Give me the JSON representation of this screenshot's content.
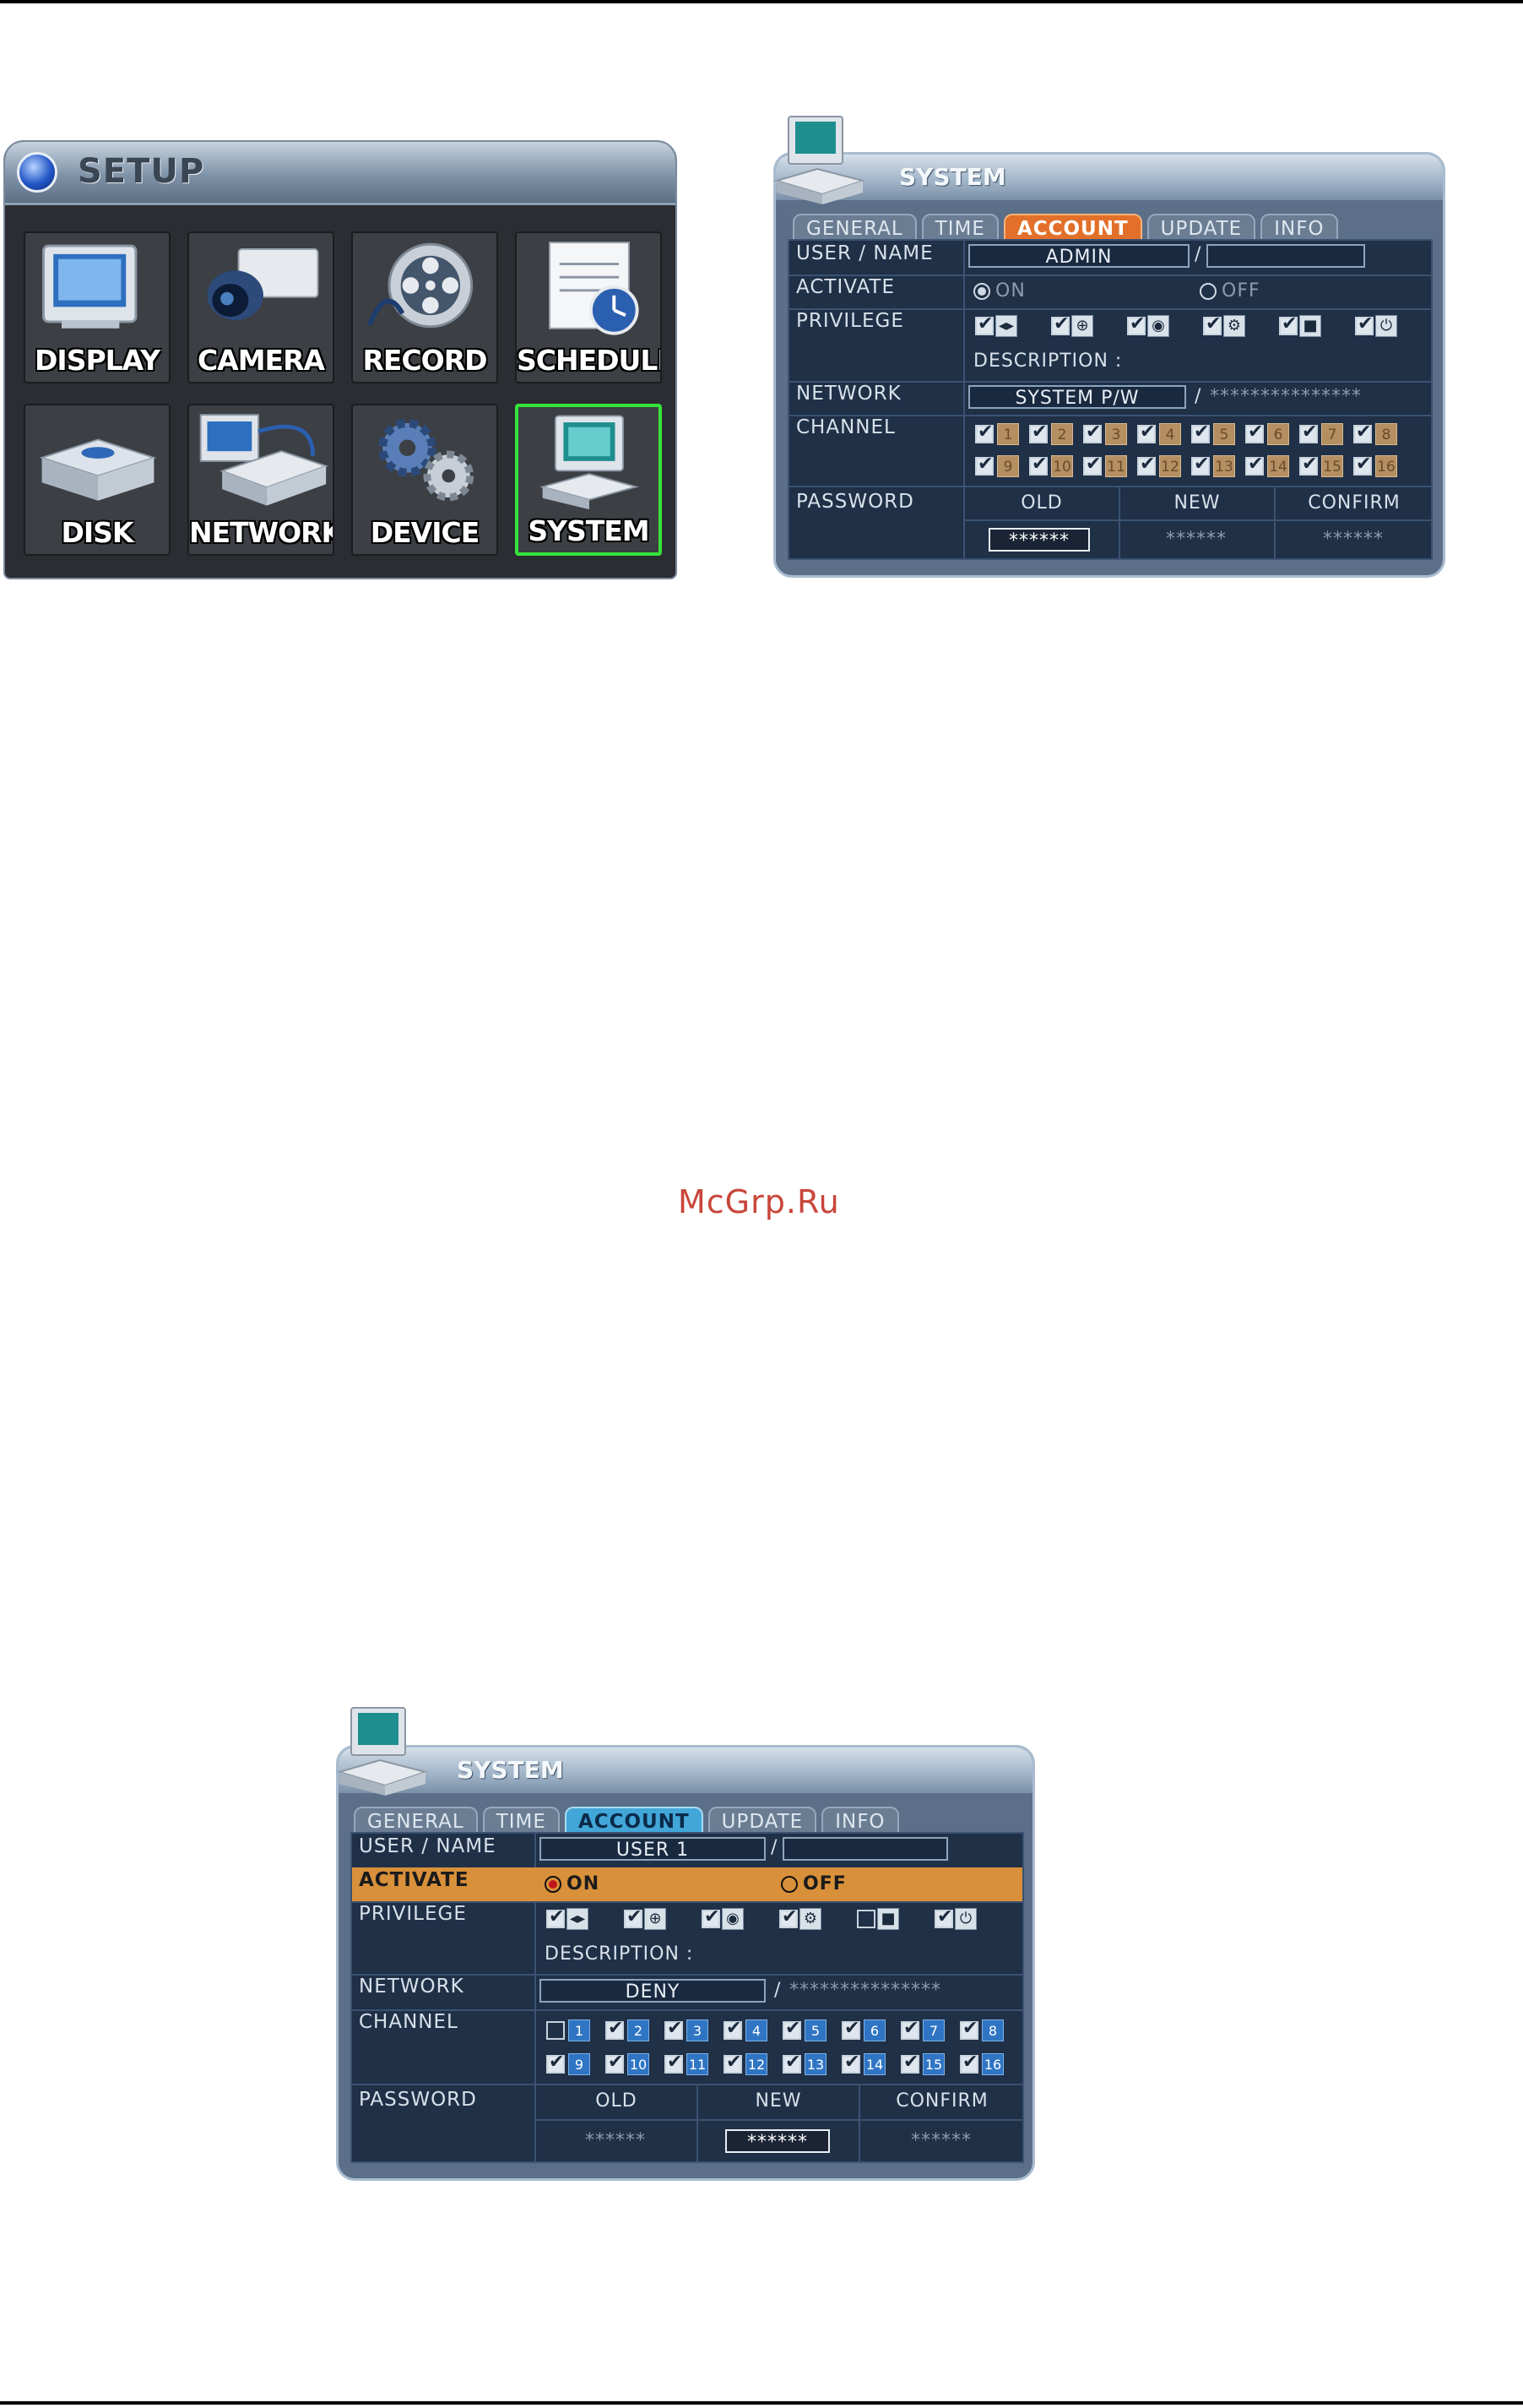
{
  "setup": {
    "title": "SETUP",
    "items": [
      {
        "label": "DISPLAY",
        "icon": "monitor-icon"
      },
      {
        "label": "CAMERA",
        "icon": "camera-icon"
      },
      {
        "label": "RECORD",
        "icon": "film-reel-icon"
      },
      {
        "label": "SCHEDULE",
        "icon": "calendar-clock-icon"
      },
      {
        "label": "DISK",
        "icon": "disk-drive-icon"
      },
      {
        "label": "NETWORK",
        "icon": "network-dvr-icon"
      },
      {
        "label": "DEVICE",
        "icon": "gears-icon"
      },
      {
        "label": "SYSTEM",
        "icon": "computer-icon"
      }
    ],
    "selected": "SYSTEM"
  },
  "system_admin": {
    "title": "SYSTEM",
    "tabs": [
      "GENERAL",
      "TIME",
      "ACCOUNT",
      "UPDATE",
      "INFO"
    ],
    "active_tab": "ACCOUNT",
    "labels": {
      "user_name": "USER / NAME",
      "activate": "ACTIVATE",
      "privilege": "PRIVILEGE",
      "network": "NETWORK",
      "channel": "CHANNEL",
      "password": "PASSWORD"
    },
    "user": "ADMIN",
    "name": "",
    "slash": "/",
    "activate_on": "ON",
    "activate_off": "OFF",
    "description_label": "DESCRIPTION :",
    "network_value": "SYSTEM P/W",
    "network_mask": "***************",
    "channels": [
      "1",
      "2",
      "3",
      "4",
      "5",
      "6",
      "7",
      "8",
      "9",
      "10",
      "11",
      "12",
      "13",
      "14",
      "15",
      "16"
    ],
    "password_cols": [
      "OLD",
      "NEW",
      "CONFIRM"
    ],
    "password_values": [
      "******",
      "******",
      "******"
    ]
  },
  "system_user": {
    "title": "SYSTEM",
    "tabs": [
      "GENERAL",
      "TIME",
      "ACCOUNT",
      "UPDATE",
      "INFO"
    ],
    "active_tab": "ACCOUNT",
    "labels": {
      "user_name": "USER / NAME",
      "activate": "ACTIVATE",
      "privilege": "PRIVILEGE",
      "network": "NETWORK",
      "channel": "CHANNEL",
      "password": "PASSWORD"
    },
    "user": "USER 1",
    "name": "",
    "slash": "/",
    "activate_on": "ON",
    "activate_off": "OFF",
    "description_label": "DESCRIPTION :",
    "network_value": "DENY",
    "network_mask": "***************",
    "channels": [
      "1",
      "2",
      "3",
      "4",
      "5",
      "6",
      "7",
      "8",
      "9",
      "10",
      "11",
      "12",
      "13",
      "14",
      "15",
      "16"
    ],
    "password_cols": [
      "OLD",
      "NEW",
      "CONFIRM"
    ],
    "password_values": [
      "******",
      "******",
      "******"
    ]
  },
  "watermark": "McGrp.Ru",
  "colors": {
    "selected_border": "#35e43a",
    "active_tab_orange": "#e2702a",
    "active_tab_blue": "#42a7d8",
    "highlight_row": "#d9903a",
    "watermark": "#c9463a"
  }
}
